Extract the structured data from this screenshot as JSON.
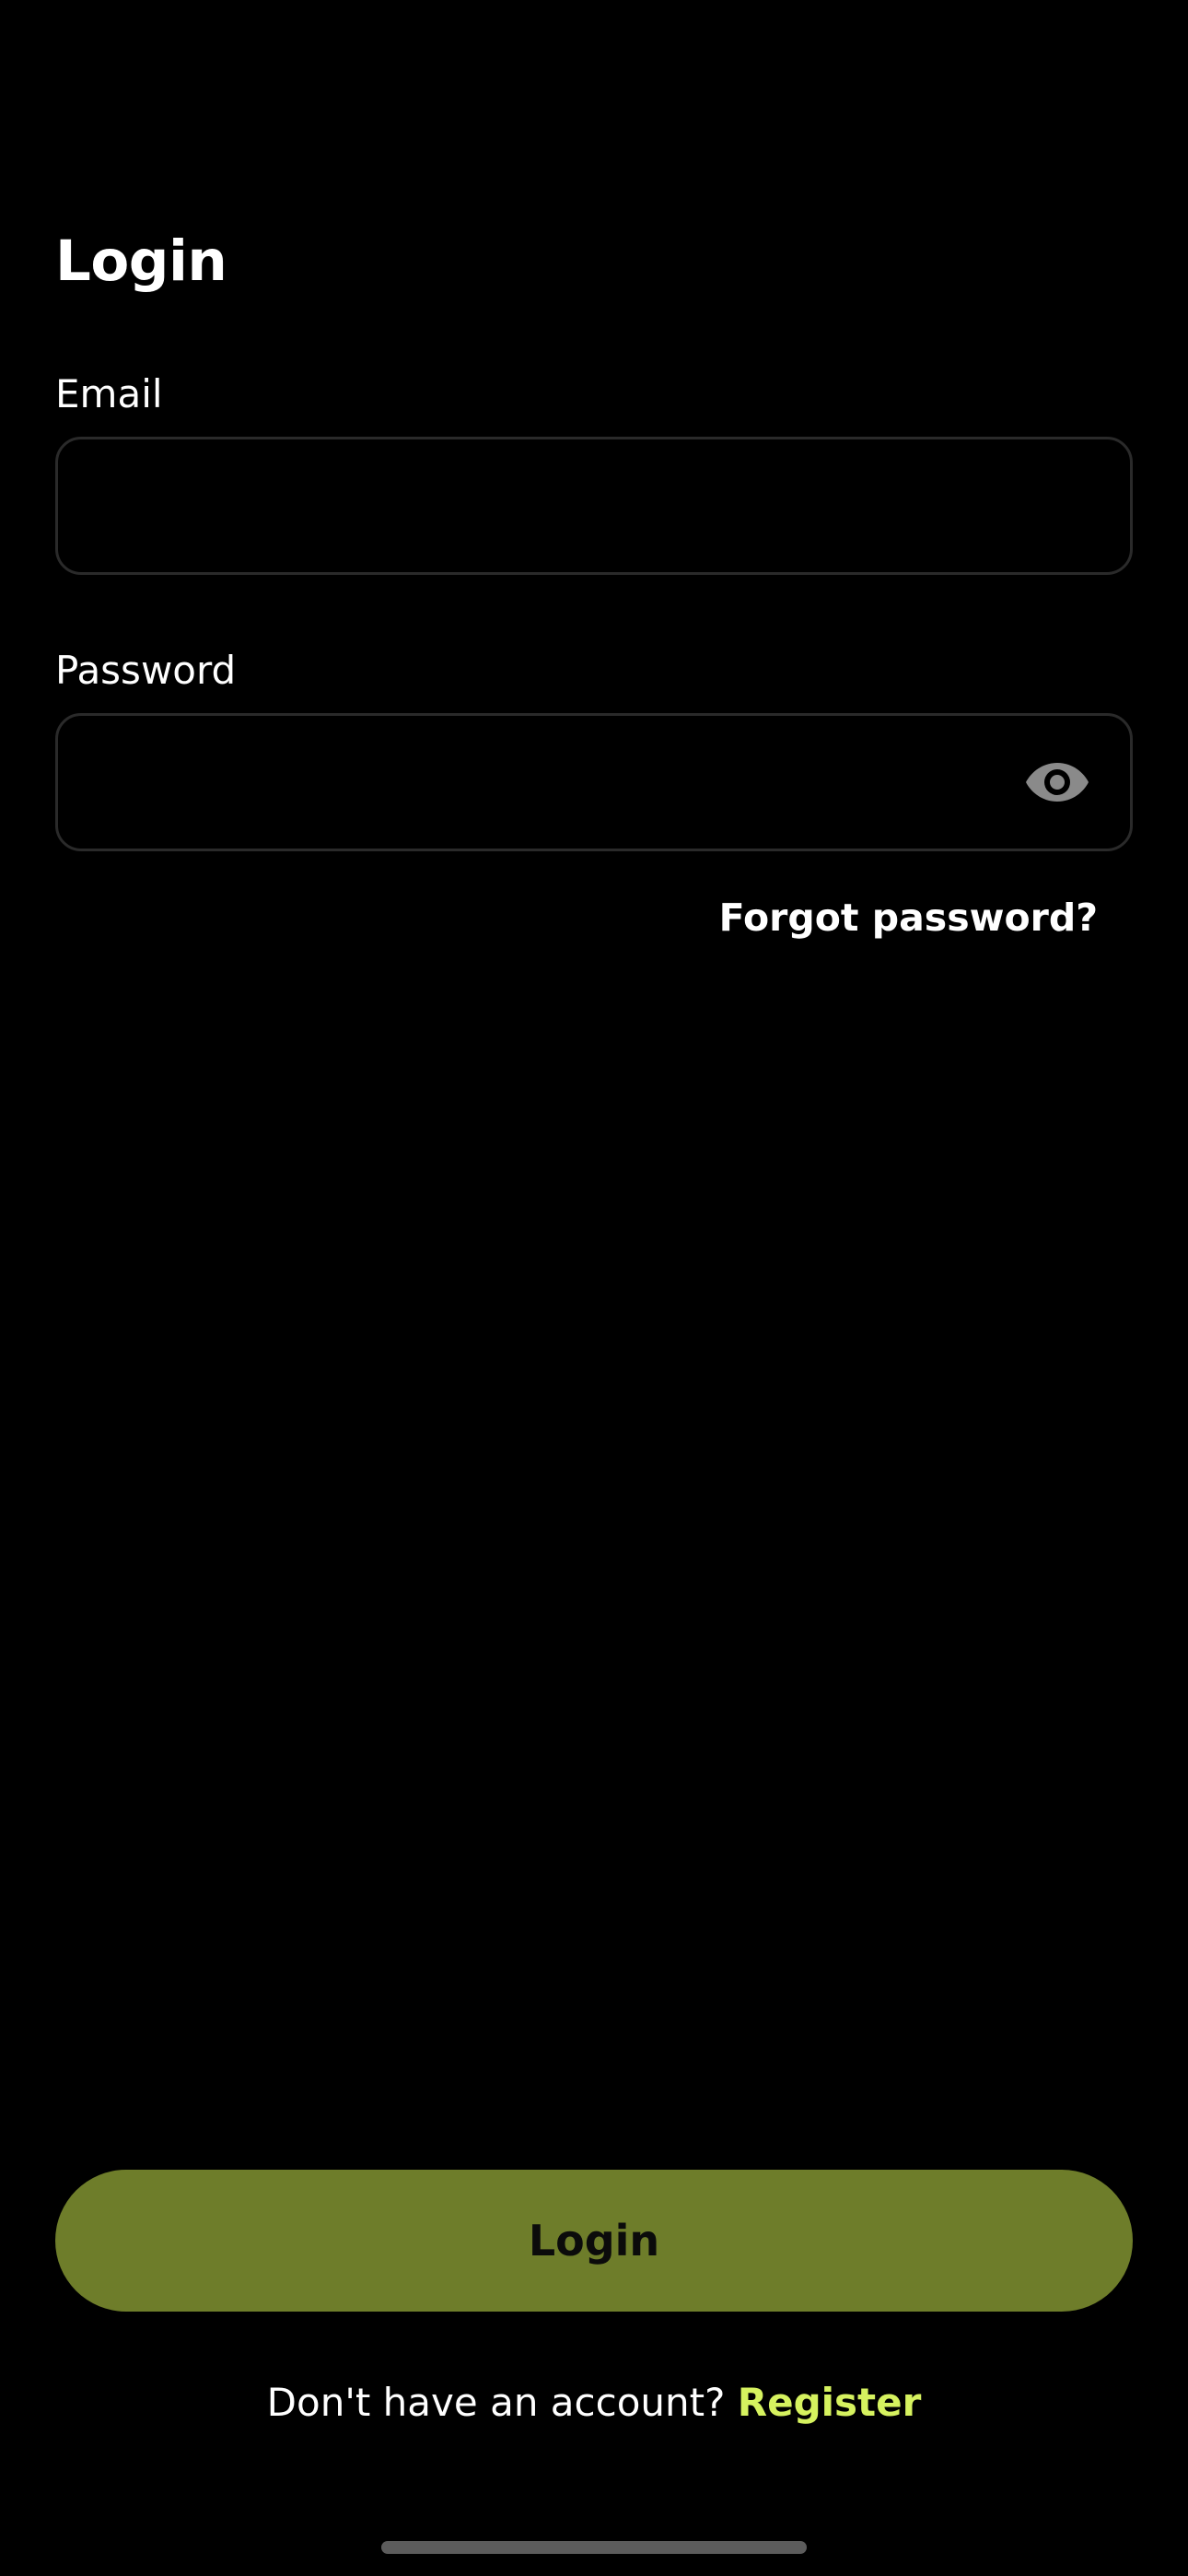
{
  "header": {
    "title": "Login"
  },
  "form": {
    "email": {
      "label": "Email",
      "value": "",
      "placeholder": ""
    },
    "password": {
      "label": "Password",
      "value": "",
      "placeholder": "",
      "toggle_icon": "eye-icon"
    },
    "forgot_password_label": "Forgot password?",
    "submit_label": "Login"
  },
  "footer": {
    "prompt": "Don't have an account?",
    "register_label": "Register"
  },
  "colors": {
    "background": "#000000",
    "primary_button": "#6e7d2a",
    "accent_link": "#d6f25f",
    "field_border": "#2a2a2a",
    "icon": "#8a8a8a"
  }
}
